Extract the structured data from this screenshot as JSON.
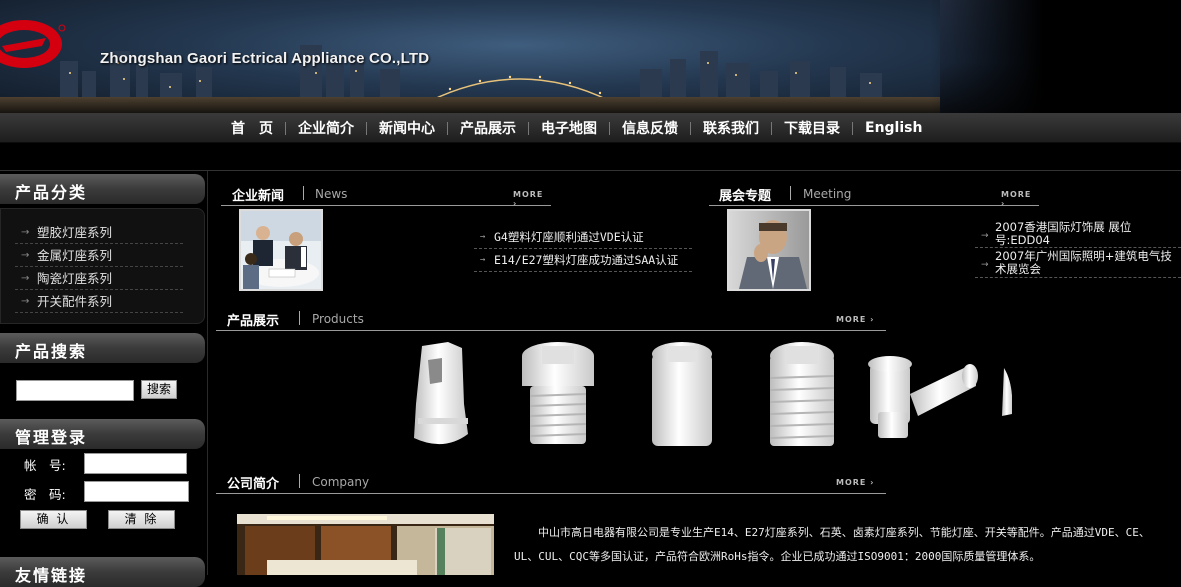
{
  "banner": {
    "company_name": "Zhongshan Gaori Ectrical Appliance CO.,LTD"
  },
  "nav": {
    "items": [
      "首　页",
      "企业简介",
      "新闻中心",
      "产品展示",
      "电子地图",
      "信息反馈",
      "联系我们",
      "下载目录",
      "English"
    ]
  },
  "sidebar": {
    "categories_title": "产品分类",
    "categories": [
      "塑胶灯座系列",
      "金属灯座系列",
      "陶瓷灯座系列",
      "开关配件系列"
    ],
    "search_title": "产品搜索",
    "search_button": "搜索",
    "search_value": "",
    "login_title": "管理登录",
    "account_label": "帐　号:",
    "password_label": "密　码:",
    "confirm_button": "确 认",
    "clear_button": "清 除",
    "links_title": "友情链接"
  },
  "news": {
    "title_cn": "企业新闻",
    "title_en": "News",
    "more": "MORE ›",
    "items": [
      "G4塑料灯座顺利通过VDE认证",
      "E14/E27塑料灯座成功通过SAA认证"
    ]
  },
  "meeting": {
    "title_cn": "展会专题",
    "title_en": "Meeting",
    "more": "MORE ›",
    "items": [
      "2007香港国际灯饰展 展位号:EDD04",
      "2007年广州国际照明+建筑电气技术展览会"
    ]
  },
  "products": {
    "title_cn": "产品展示",
    "title_en": "Products",
    "more": "MORE ›"
  },
  "company": {
    "title_cn": "公司简介",
    "title_en": "Company",
    "more": "MORE ›",
    "intro": "中山市高日电器有限公司是专业生产E14、E27灯座系列、石英、卤素灯座系列、节能灯座、开关等配件。产品通过VDE、CE、UL、CUL、CQC等多国认证，产品符合欧洲RoHs指令。企业已成功通过ISO9001：2000国际质量管理体系。"
  },
  "colors": {
    "background": "#000000",
    "nav_text": "#ffffff",
    "accent_logo": "#d40010"
  }
}
